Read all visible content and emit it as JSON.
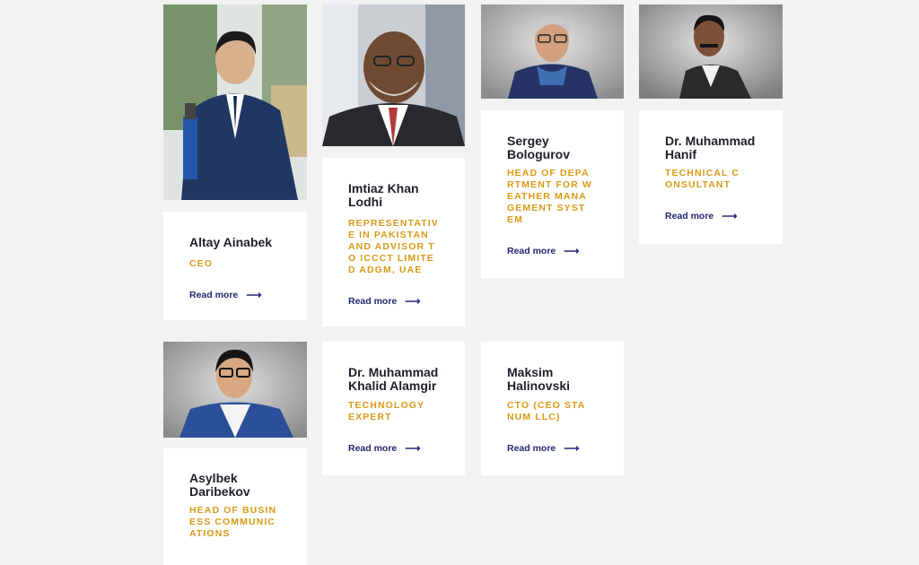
{
  "team": [
    {
      "name": "Altay Ainabek",
      "role": "CEO",
      "link": "Read more",
      "photo": "portrait-man-suit-microphone"
    },
    {
      "name": "Imtiaz Khan Lodhi",
      "role": "REPRESENTATIVE IN PAKISTAN AND ADVISOR TO ICCCT LIMITED ADGM, UAE",
      "link": "Read more",
      "photo": "portrait-man-glasses-grey-beard"
    },
    {
      "name": "Sergey Bologurov",
      "role": "HEAD OF DEPARTMENT FOR WEATHER MANAGEMENT SYSTEM",
      "link": "Read more",
      "photo": "portrait-man-glasses-scarf"
    },
    {
      "name": "Dr. Muhammad Hanif",
      "role": "TECHNICAL CONSULTANT",
      "link": "Read more",
      "photo": "portrait-man-moustache-suit"
    },
    {
      "name": "Asylbek Daribekov",
      "role": "HEAD OF BUSINESS COMMUNICATIONS",
      "link": "Read more",
      "photo": "portrait-man-glasses-smiling"
    },
    {
      "name": "Dr. Muhammad Khalid Alamgir",
      "role": "TECHNOLOGY EXPERT",
      "link": "Read more",
      "photo": null
    },
    {
      "name": "Maksim Halinovski",
      "role": "CTO (CEO STANUM LLC)",
      "link": "Read more",
      "photo": null
    }
  ],
  "arrow_glyph": "⟶"
}
